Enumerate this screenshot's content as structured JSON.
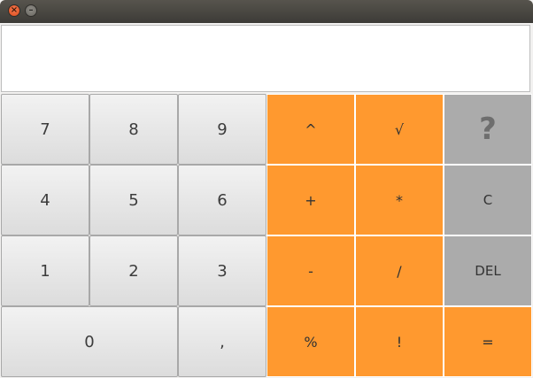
{
  "titlebar": {
    "close_glyph": "×",
    "minimize_glyph": "–"
  },
  "display": {
    "value": ""
  },
  "keys": {
    "seven": "7",
    "eight": "8",
    "nine": "9",
    "power": "^",
    "sqrt": "√",
    "help": "?",
    "four": "4",
    "five": "5",
    "six": "6",
    "plus": "+",
    "multiply": "*",
    "clear": "C",
    "one": "1",
    "two": "2",
    "three": "3",
    "minus": "-",
    "divide": "/",
    "delete": "DEL",
    "zero": "0",
    "comma": ",",
    "percent": "%",
    "factorial": "!",
    "equals": "="
  },
  "colors": {
    "operator_key": "#ff992f",
    "function_key": "#ababab",
    "number_key": "#e6e6e6",
    "titlebar": "#3c3b37"
  }
}
